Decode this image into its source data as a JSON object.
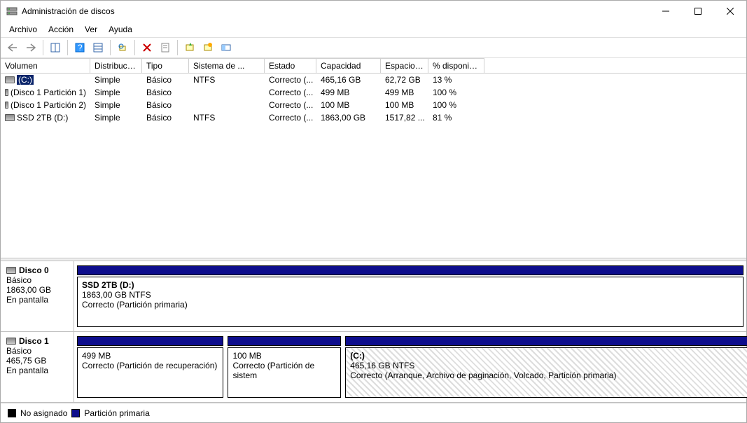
{
  "window": {
    "title": "Administración de discos"
  },
  "menu": [
    "Archivo",
    "Acción",
    "Ver",
    "Ayuda"
  ],
  "columns": [
    "Volumen",
    "Distribución",
    "Tipo",
    "Sistema de ...",
    "Estado",
    "Capacidad",
    "Espacio ...",
    "% disponible"
  ],
  "volumes": [
    {
      "name": "(C:)",
      "dist": "Simple",
      "tipo": "Básico",
      "fs": "NTFS",
      "estado": "Correcto (...",
      "cap": "465,16 GB",
      "free": "62,72 GB",
      "pct": "13 %",
      "selected": true
    },
    {
      "name": "(Disco 1 Partición 1)",
      "dist": "Simple",
      "tipo": "Básico",
      "fs": "",
      "estado": "Correcto (...",
      "cap": "499 MB",
      "free": "499 MB",
      "pct": "100 %"
    },
    {
      "name": "(Disco 1 Partición 2)",
      "dist": "Simple",
      "tipo": "Básico",
      "fs": "",
      "estado": "Correcto (...",
      "cap": "100 MB",
      "free": "100 MB",
      "pct": "100 %"
    },
    {
      "name": "SSD 2TB (D:)",
      "dist": "Simple",
      "tipo": "Básico",
      "fs": "NTFS",
      "estado": "Correcto (...",
      "cap": "1863,00 GB",
      "free": "1517,82 ...",
      "pct": "81 %"
    }
  ],
  "disks": [
    {
      "name": "Disco 0",
      "type": "Básico",
      "size": "1863,00 GB",
      "status": "En pantalla",
      "parts": [
        {
          "title": "SSD 2TB  (D:)",
          "line2": "1863,00 GB NTFS",
          "line3": "Correcto (Partición primaria)",
          "flex": "100%",
          "hatched": false
        }
      ]
    },
    {
      "name": "Disco 1",
      "type": "Básico",
      "size": "465,75 GB",
      "status": "En pantalla",
      "parts": [
        {
          "title": "",
          "line2": "499 MB",
          "line3": "Correcto (Partición de recuperación)",
          "flex": "22%",
          "hatched": false
        },
        {
          "title": "",
          "line2": "100 MB",
          "line3": "Correcto (Partición de sistem",
          "flex": "17%",
          "hatched": false
        },
        {
          "title": "(C:)",
          "line2": "465,16 GB NTFS",
          "line3": "Correcto (Arranque, Archivo de paginación, Volcado, Partición primaria)",
          "flex": "61%",
          "hatched": true
        }
      ]
    }
  ],
  "legend": {
    "unalloc": "No asignado",
    "primary": "Partición primaria"
  }
}
